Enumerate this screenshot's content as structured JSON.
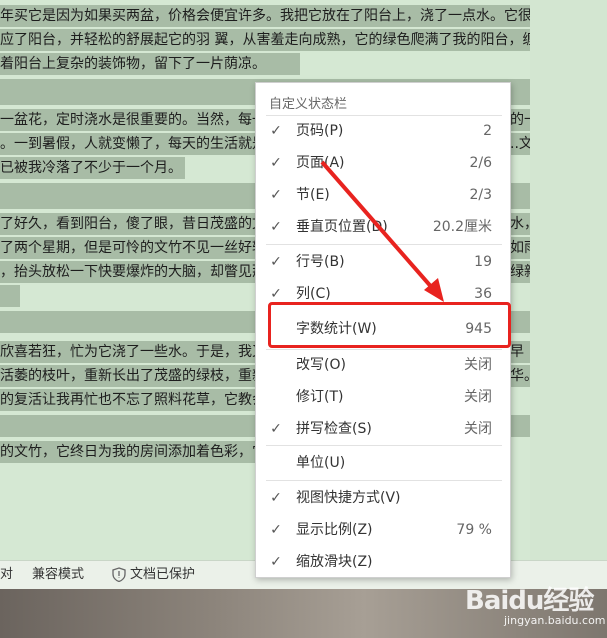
{
  "document": {
    "lines": [
      "年买它是因为如果买两盆，价格会便宜许多。我把它放在了阳台上，浇了一点水。它很快",
      "应了阳台，并轻松的舒展起它的羽 翼，从害羞走向成熟，它的绿色爬满了我的阳台，缠",
      "着阳台上复杂的装饰物，留下了一片荫凉。",
      "一盆花，定时浇水是很重要的。当然，每一",
      "。一到暑假，人就变懒了，每天的生活就是",
      "已被我冷落了不少于一个月。",
      "了好久，看到阳台，傻了眼，昔日茂盛的文",
      "了两个星期，但是可怜的文竹不见一丝好转",
      "，抬头放松一下快要爆炸的大脑，却瞥见那",
      "欣喜若狂，忙为它浇了一些水。于是，我又",
      "活萎的枝叶，重新长出了茂盛的绿枝，重新",
      "的复活让我再忙也不忘了照料花草，它教会",
      "的文竹，它终日为我的房间添加着色彩，它"
    ],
    "right_fragments": [
      "的一",
      "..文",
      "水，",
      "如雨",
      "绿新",
      "早",
      "华。"
    ]
  },
  "status_bar": {
    "left_cut": "对",
    "compat_mode": "兼容模式",
    "protected": "文档已保护"
  },
  "menu": {
    "title": "自定义状态栏",
    "items": [
      {
        "label": "页码(P)",
        "value": "2",
        "checked": true
      },
      {
        "label": "页面(A)",
        "value": "2/6",
        "checked": true
      },
      {
        "label": "节(E)",
        "value": "2/3",
        "checked": true
      },
      {
        "label": "垂直页位置(D)",
        "value": "20.2厘米",
        "checked": true
      },
      {
        "label": "行号(B)",
        "value": "19",
        "checked": true
      },
      {
        "label": "列(C)",
        "value": "36",
        "checked": true
      },
      {
        "label": "字数统计(W)",
        "value": "945",
        "checked": false
      },
      {
        "label": "改写(O)",
        "value": "关闭",
        "checked": false
      },
      {
        "label": "修订(T)",
        "value": "关闭",
        "checked": false
      },
      {
        "label": "拼写检查(S)",
        "value": "关闭",
        "checked": true
      },
      {
        "label": "单位(U)",
        "value": "",
        "checked": false
      },
      {
        "label": "视图快捷方式(V)",
        "value": "",
        "checked": true
      },
      {
        "label": "显示比例(Z)",
        "value": "79 %",
        "checked": true
      },
      {
        "label": "缩放滑块(Z)",
        "value": "",
        "checked": true
      }
    ]
  },
  "watermark": {
    "brand": "Baidu经验",
    "url": "jingyan.baidu.com"
  },
  "colors": {
    "highlight": "#e8231f",
    "arrow": "#e8231f",
    "doc_bg": "#d5e8d3"
  }
}
